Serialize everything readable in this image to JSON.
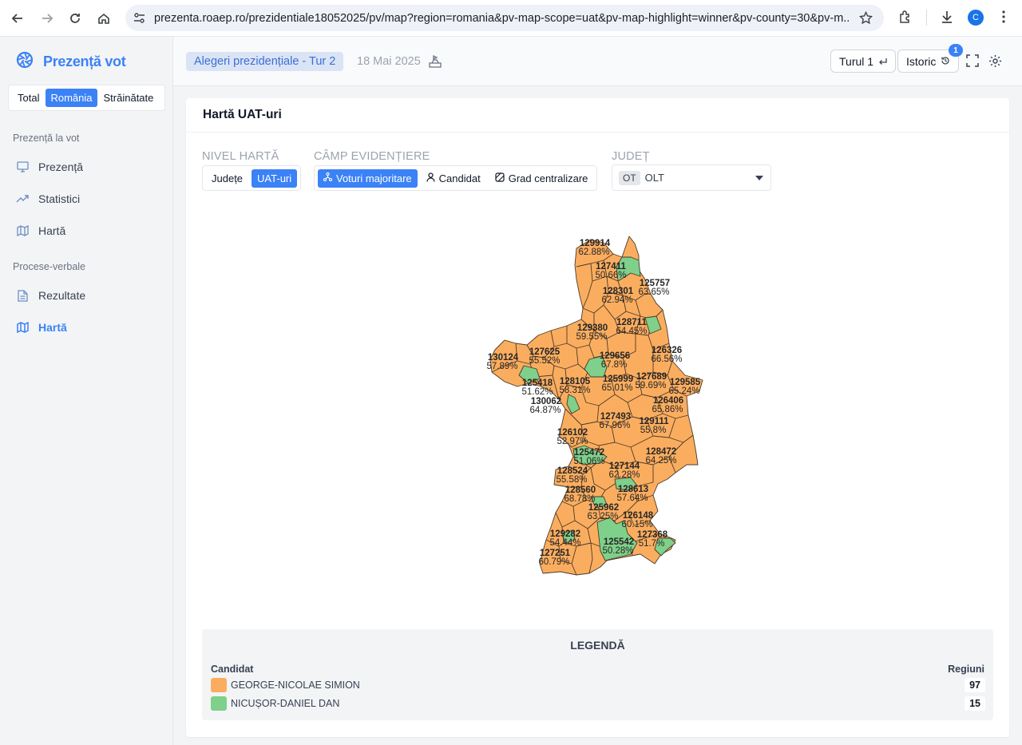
{
  "browser": {
    "url": "prezenta.roaep.ro/prezidentiale18052025/pv/map?region=romania&pv-map-scope=uat&pv-map-highlight=winner&pv-county=30&pv-m...",
    "profile_initial": "C"
  },
  "sidebar": {
    "brand": "Prezență vot",
    "scope_tabs": [
      {
        "label": "Total"
      },
      {
        "label": "România"
      },
      {
        "label": "Străinătate"
      }
    ],
    "section_presence": "Prezență la vot",
    "presence_items": [
      {
        "label": "Prezență"
      },
      {
        "label": "Statistici"
      },
      {
        "label": "Hartă"
      }
    ],
    "section_pv": "Procese-verbale",
    "pv_items": [
      {
        "label": "Rezultate"
      },
      {
        "label": "Hartă"
      }
    ]
  },
  "header": {
    "election": "Alegeri prezidențiale - Tur 2",
    "date": "18 Mai 2025",
    "round_button": "Turul 1",
    "history_button": "Istoric",
    "history_badge": "1"
  },
  "card": {
    "title": "Hartă UAT-uri",
    "map_level_label": "NIVEL HARTĂ",
    "map_level_options": [
      {
        "label": "Județe"
      },
      {
        "label": "UAT-uri"
      }
    ],
    "highlight_label": "CÂMP EVIDENȚIERE",
    "highlight_options": [
      {
        "label": "Voturi majoritare"
      },
      {
        "label": "Candidat"
      },
      {
        "label": "Grad centralizare"
      }
    ],
    "county_label": "JUDEȚ",
    "county_code": "OT",
    "county_name": "OLT"
  },
  "colors": {
    "accent": "#3b82f6",
    "simion": "#fbad5f",
    "dan": "#7fd08a"
  },
  "map_labels": [
    {
      "id": "129914",
      "pct": "62.88%"
    },
    {
      "id": "127411",
      "pct": "50.66%"
    },
    {
      "id": "125757",
      "pct": "63.65%"
    },
    {
      "id": "128301",
      "pct": "62.94%"
    },
    {
      "id": "128711",
      "pct": "64.45%"
    },
    {
      "id": "129380",
      "pct": "59.55%"
    },
    {
      "id": "130124",
      "pct": "57.89%"
    },
    {
      "id": "127625",
      "pct": "55.52%"
    },
    {
      "id": "129656",
      "pct": "67.8%"
    },
    {
      "id": "126326",
      "pct": "66.56%"
    },
    {
      "id": "125418",
      "pct": "51.62%"
    },
    {
      "id": "128105",
      "pct": "58.31%"
    },
    {
      "id": "125999",
      "pct": "65.01%"
    },
    {
      "id": "127689",
      "pct": "59.69%"
    },
    {
      "id": "129585",
      "pct": "65.24%"
    },
    {
      "id": "130062",
      "pct": "64.87%"
    },
    {
      "id": "126406",
      "pct": "65.86%"
    },
    {
      "id": "127493",
      "pct": "67.96%"
    },
    {
      "id": "129111",
      "pct": "55.8%"
    },
    {
      "id": "126102",
      "pct": "52.97%"
    },
    {
      "id": "125472",
      "pct": "51.06%"
    },
    {
      "id": "128472",
      "pct": "64.25%"
    },
    {
      "id": "127144",
      "pct": "62.28%"
    },
    {
      "id": "128524",
      "pct": "55.58%"
    },
    {
      "id": "128560",
      "pct": "68.78%"
    },
    {
      "id": "128613",
      "pct": "57.64%"
    },
    {
      "id": "125962",
      "pct": "63.25%"
    },
    {
      "id": "126148",
      "pct": "60.15%"
    },
    {
      "id": "129282",
      "pct": "54.44%"
    },
    {
      "id": "127368",
      "pct": "51.7%"
    },
    {
      "id": "125542",
      "pct": "50.28%"
    },
    {
      "id": "127251",
      "pct": "60.79%"
    }
  ],
  "legend": {
    "title": "LEGENDĂ",
    "col_candidate": "Candidat",
    "col_regions": "Regiuni",
    "rows": [
      {
        "name": "GEORGE-NICOLAE SIMION",
        "count": "97",
        "color": "#fbad5f"
      },
      {
        "name": "NICUȘOR-DANIEL DAN",
        "count": "15",
        "color": "#7fd08a"
      }
    ]
  }
}
